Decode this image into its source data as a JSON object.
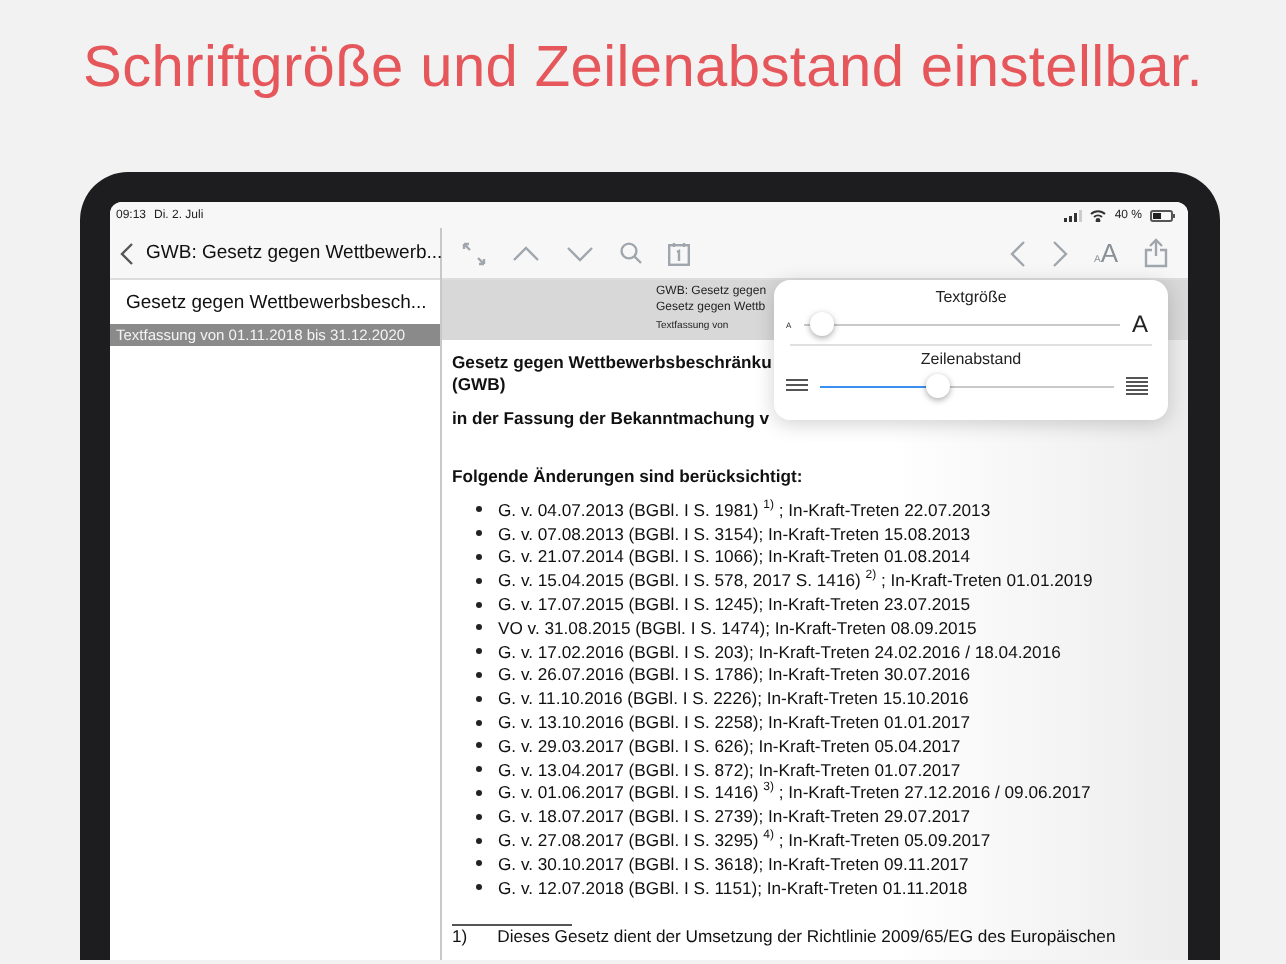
{
  "headline": "Schriftgröße und Zeilenabstand einstellbar.",
  "status_bar": {
    "time": "09:13",
    "date": "Di. 2. Juli",
    "battery": "40 %"
  },
  "sidebar": {
    "title": "GWB: Gesetz gegen Wettbewerb...",
    "items": [
      {
        "label": "Gesetz gegen Wettbewerbsbesch...",
        "kind": "entry"
      },
      {
        "label": "Textfassung von 01.11.2018 bis 31.12.2020",
        "kind": "header"
      }
    ]
  },
  "toolbar": {
    "text_size": {
      "small": "A",
      "large": "A"
    }
  },
  "document": {
    "banner": [
      "GWB: Gesetz gegen",
      "Gesetz gegen Wettb",
      "Textfassung von"
    ],
    "title": "Gesetz gegen Wettbewerbsbeschränku",
    "subtitle": "(GWB)",
    "version": "in der Fassung der Bekanntmachung v",
    "changes_heading": "Folgende Änderungen sind berücksichtigt:",
    "changes": [
      "G. v. 04.07.2013 (BGBl. I S. 1981)  $^{1)}$ ; In-Kraft-Treten 22.07.2013",
      "G. v. 07.08.2013 (BGBl. I S. 3154); In-Kraft-Treten 15.08.2013",
      "G. v. 21.07.2014 (BGBl. I S. 1066); In-Kraft-Treten 01.08.2014",
      "G. v. 15.04.2015 (BGBl. I S. 578, 2017 S. 1416)  $^{2)}$ ; In-Kraft-Treten 01.01.2019",
      "G. v. 17.07.2015 (BGBl. I S. 1245); In-Kraft-Treten 23.07.2015",
      "VO v. 31.08.2015 (BGBl. I S. 1474); In-Kraft-Treten 08.09.2015",
      "G. v. 17.02.2016 (BGBl. I S. 203); In-Kraft-Treten 24.02.2016 / 18.04.2016",
      "G. v. 26.07.2016 (BGBl. I S. 1786); In-Kraft-Treten 30.07.2016",
      "G. v. 11.10.2016 (BGBl. I S. 2226); In-Kraft-Treten 15.10.2016",
      "G. v. 13.10.2016 (BGBl. I S. 2258); In-Kraft-Treten 01.01.2017",
      "G. v. 29.03.2017 (BGBl. I S. 626); In-Kraft-Treten 05.04.2017",
      "G. v. 13.04.2017 (BGBl. I S. 872); In-Kraft-Treten 01.07.2017",
      "G. v. 01.06.2017 (BGBl. I S. 1416)  $^{3)}$ ; In-Kraft-Treten 27.12.2016 / 09.06.2017",
      "G. v. 18.07.2017 (BGBl. I S. 2739); In-Kraft-Treten 29.07.2017",
      "G. v. 27.08.2017 (BGBl. I S. 3295)  $^{4)}$ ; In-Kraft-Treten 05.09.2017",
      "G. v. 30.10.2017 (BGBl. I S. 3618); In-Kraft-Treten 09.11.2017",
      "G. v. 12.07.2018 (BGBl. I S. 1151); In-Kraft-Treten 01.11.2018"
    ],
    "footnotes": [
      {
        "mark": "1)",
        "text": "Dieses Gesetz dient der Umsetzung der Richtlinie 2009/65/EG des Europäischen"
      }
    ]
  },
  "popover": {
    "text_size": {
      "title": "Textgröße",
      "small": "A",
      "large": "A",
      "level": 0.06
    },
    "line_spacing": {
      "title": "Zeilenabstand",
      "level": 0.4
    }
  }
}
